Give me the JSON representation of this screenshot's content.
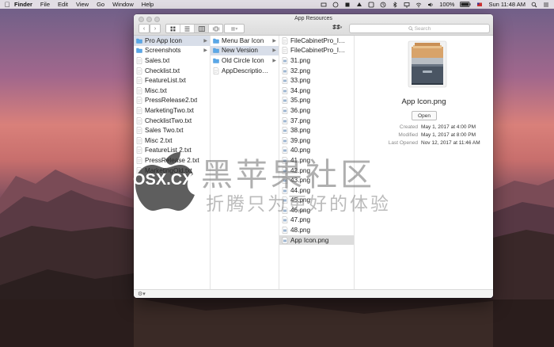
{
  "menubar": {
    "app": "Finder",
    "items": [
      "File",
      "Edit",
      "View",
      "Go",
      "Window",
      "Help"
    ],
    "battery": "100%",
    "clock": "Sun 11:48 AM"
  },
  "window": {
    "title": "App Resources",
    "search_placeholder": "Search"
  },
  "column1": [
    {
      "label": "Pro App Icon",
      "type": "folder",
      "state": "selected",
      "has_children": true
    },
    {
      "label": "Screenshots",
      "type": "folder",
      "has_children": true
    },
    {
      "label": "Sales.txt",
      "type": "file"
    },
    {
      "label": "Checklist.txt",
      "type": "file"
    },
    {
      "label": "FeatureList.txt",
      "type": "file"
    },
    {
      "label": "Misc.txt",
      "type": "file"
    },
    {
      "label": "PressRelease2.txt",
      "type": "file"
    },
    {
      "label": "MarketingTwo.txt",
      "type": "file"
    },
    {
      "label": "ChecklistTwo.txt",
      "type": "file"
    },
    {
      "label": "Sales Two.txt",
      "type": "file"
    },
    {
      "label": "Misc 2.txt",
      "type": "file"
    },
    {
      "label": "FeatureList 2.txt",
      "type": "file"
    },
    {
      "label": "PressRelease 2.txt",
      "type": "file"
    },
    {
      "label": "MarketingOld.txt",
      "type": "file"
    }
  ],
  "column2": [
    {
      "label": "Menu Bar Icon",
      "type": "folder",
      "has_children": true
    },
    {
      "label": "New Version",
      "type": "folder",
      "state": "selected",
      "has_children": true
    },
    {
      "label": "Old Circle Icon",
      "type": "folder",
      "has_children": true
    },
    {
      "label": "AppDescriptio…",
      "type": "file"
    }
  ],
  "column3": [
    {
      "label": "FileCabinetPro_I…",
      "type": "file"
    },
    {
      "label": "FileCabinetPro_I…",
      "type": "file"
    },
    {
      "label": "31.png",
      "type": "image"
    },
    {
      "label": "32.png",
      "type": "image"
    },
    {
      "label": "33.png",
      "type": "image"
    },
    {
      "label": "34.png",
      "type": "image"
    },
    {
      "label": "35.png",
      "type": "image"
    },
    {
      "label": "36.png",
      "type": "image"
    },
    {
      "label": "37.png",
      "type": "image"
    },
    {
      "label": "38.png",
      "type": "image"
    },
    {
      "label": "39.png",
      "type": "image"
    },
    {
      "label": "40.png",
      "type": "image"
    },
    {
      "label": "41.png",
      "type": "image"
    },
    {
      "label": "42.png",
      "type": "image"
    },
    {
      "label": "43.png",
      "type": "image"
    },
    {
      "label": "44.png",
      "type": "image"
    },
    {
      "label": "45.png",
      "type": "image"
    },
    {
      "label": "46.png",
      "type": "image"
    },
    {
      "label": "47.png",
      "type": "image"
    },
    {
      "label": "48.png",
      "type": "image"
    },
    {
      "label": "App Icon.png",
      "type": "image",
      "state": "selected"
    }
  ],
  "preview": {
    "filename": "App Icon.png",
    "open_label": "Open",
    "meta": [
      {
        "key": "Created",
        "value": "May 1, 2017 at 4:00 PM"
      },
      {
        "key": "Modified",
        "value": "May 1, 2017 at 8:00 PM"
      },
      {
        "key": "Last Opened",
        "value": "Nov 12, 2017 at 11:46 AM"
      }
    ]
  },
  "watermark": {
    "line1": "黑苹果社区",
    "site": "OSX.CX",
    "line2": "折腾只为更好的体验"
  }
}
